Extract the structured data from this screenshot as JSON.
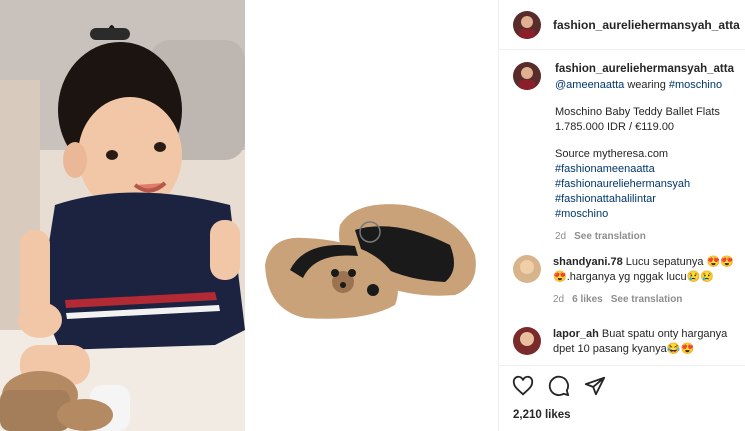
{
  "post": {
    "username": "fashion_aureliehermansyah_atta",
    "caption": {
      "username": "fashion_aureliehermansyah_atta",
      "mention": "@ameenaatta",
      "wearing_text": " wearing ",
      "brand_tag": "#moschino",
      "product_name": "Moschino Baby Teddy Ballet Flats",
      "price": "1.785.000 IDR / €119.00",
      "source": "Source mytheresa.com",
      "tag1": "#fashionameenaatta",
      "tag2": "#fashionaureliehermansyah",
      "tag3": "#fashionattahalilintar",
      "tag4": "#moschino",
      "time": "2d",
      "see_translation": "See translation"
    },
    "comments": [
      {
        "username": "shandyani.78",
        "text": "Lucu sepatunya 😍😍😍.harganya yg nggak lucu😢😢",
        "time": "2d",
        "likes": "6 likes",
        "see_translation": "See translation"
      },
      {
        "username": "lapor_ah",
        "text": "Buat spatu onty harganya dpet 10 pasang kyanya😂😍"
      }
    ],
    "likes_count": "2,210 likes"
  },
  "colors": {
    "link": "#00376b",
    "muted": "#8e8e8e",
    "text": "#262626",
    "teddy": "#c9a27a",
    "dress": "#1c2340"
  },
  "icons": [
    "heart-icon",
    "comment-icon",
    "share-icon"
  ]
}
